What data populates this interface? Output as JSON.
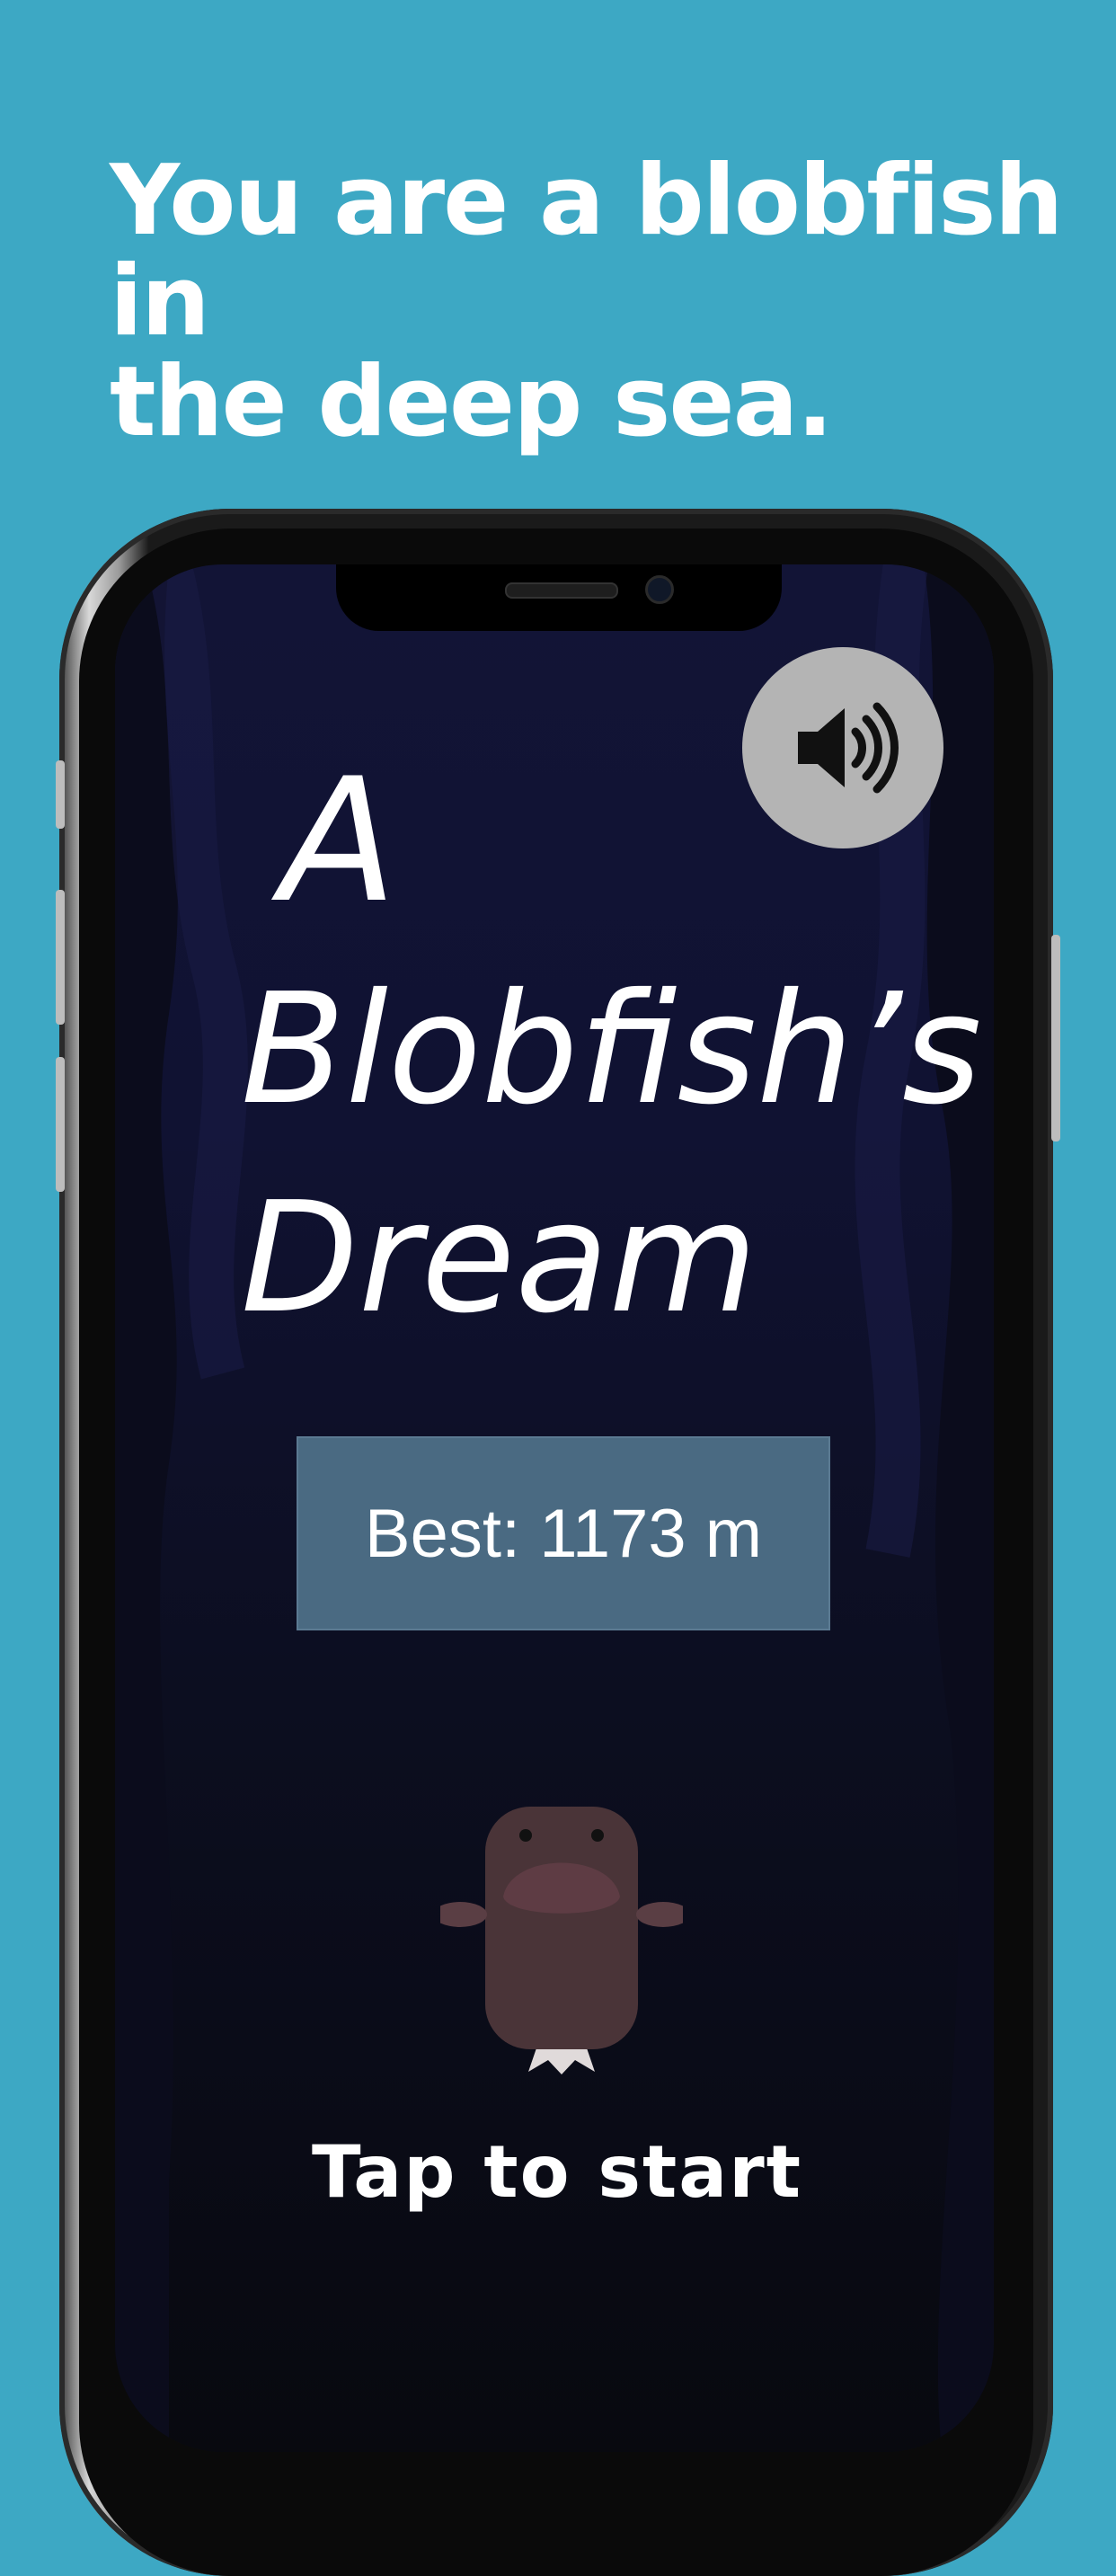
{
  "headline": {
    "line1": "You are a blobfish in",
    "line2": "the deep sea."
  },
  "game": {
    "title_lines": [
      "A",
      "Blobfish’s",
      "Dream"
    ],
    "best_score": "Best: 1173 m",
    "tap_prompt": "Tap to start",
    "sound_icon": "speaker-volume-icon"
  },
  "colors": {
    "background": "#3da8c4",
    "screen_top": "#121436",
    "screen_bottom": "#08090f",
    "best_box": "#4a6a82",
    "sound_button": "#b4b4b4",
    "blobfish": "#4a3438"
  }
}
